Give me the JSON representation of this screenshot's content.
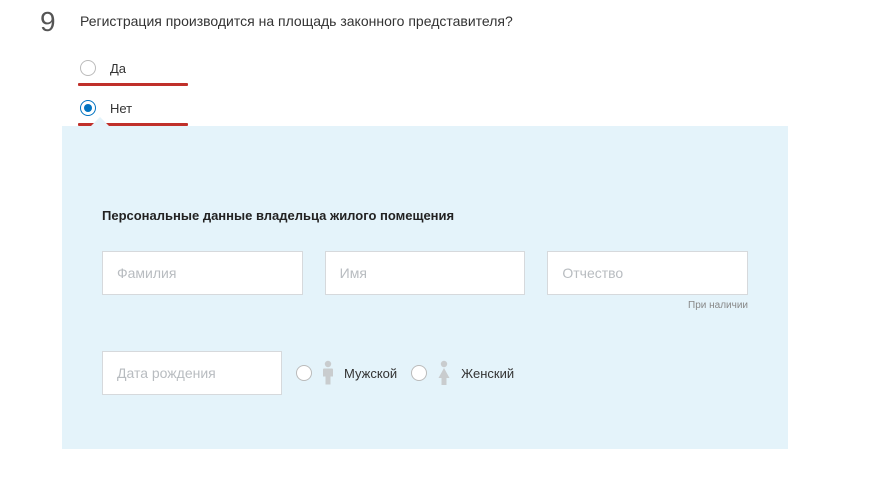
{
  "question": {
    "number": "9",
    "text": "Регистрация производится на площадь законного представителя?"
  },
  "options": {
    "yes": "Да",
    "no": "Нет"
  },
  "panel": {
    "title": "Персональные данные владельца жилого помещения"
  },
  "fields": {
    "lastname_placeholder": "Фамилия",
    "firstname_placeholder": "Имя",
    "patronymic_placeholder": "Отчество",
    "patronymic_hint": "При наличии",
    "dob_placeholder": "Дата рождения"
  },
  "gender": {
    "male": "Мужской",
    "female": "Женский"
  }
}
